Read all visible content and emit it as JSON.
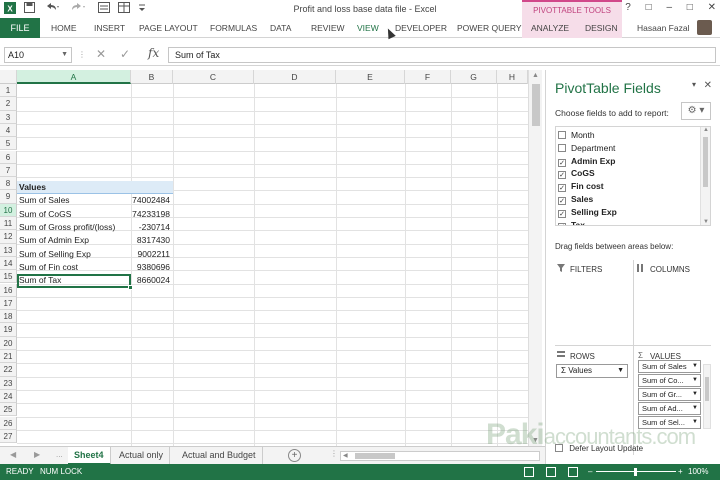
{
  "titlebar": {
    "title": "Profit and loss base data file - Excel",
    "pivot_tools": "PIVOTTABLE TOOLS",
    "help": "?",
    "restore": "□",
    "minimize": "–",
    "restore2": "□",
    "close": "✕"
  },
  "ribbon": {
    "file": "FILE",
    "tabs": [
      "HOME",
      "INSERT",
      "PAGE LAYOUT",
      "FORMULAS",
      "DATA",
      "REVIEW",
      "VIEW",
      "DEVELOPER",
      "POWER QUERY",
      "ANALYZE",
      "DESIGN"
    ],
    "user": "Hasaan Fazal"
  },
  "formula_bar": {
    "name_box": "A10",
    "formula": "Sum of Tax",
    "fx": "fx"
  },
  "grid": {
    "columns": [
      "A",
      "B",
      "C",
      "D",
      "E",
      "F",
      "G",
      "H"
    ],
    "rows": [
      "1",
      "2",
      "3",
      "4",
      "5",
      "6",
      "7",
      "8",
      "9",
      "10",
      "11",
      "12",
      "13",
      "14",
      "15",
      "16",
      "17",
      "18",
      "19",
      "20",
      "21",
      "22",
      "23",
      "24",
      "25",
      "26",
      "27"
    ],
    "header_label": "Values",
    "cells": [
      {
        "label": "Sum of Sales",
        "value": "74002484"
      },
      {
        "label": "Sum of CoGS",
        "value": "74233198"
      },
      {
        "label": "Sum of Gross profit/(loss)",
        "value": "-230714"
      },
      {
        "label": "Sum of Admin Exp",
        "value": "8317430"
      },
      {
        "label": "Sum of Selling Exp",
        "value": "9002211"
      },
      {
        "label": "Sum of Fin cost",
        "value": "9380696"
      },
      {
        "label": "Sum of Tax",
        "value": "8660024"
      }
    ]
  },
  "sheets": {
    "tabs": [
      "Sheet4",
      "Actual only",
      "Actual and Budget"
    ],
    "nav_prev": "◀",
    "nav_next": "▶",
    "more": "...",
    "add": "+"
  },
  "status": {
    "ready": "READY",
    "numlock": "NUM LOCK",
    "zoom": "100%",
    "minus": "–",
    "plus": "+"
  },
  "pivot": {
    "title": "PivotTable Fields",
    "subtitle": "Choose fields to add to report:",
    "fields": [
      {
        "name": "Month",
        "checked": false
      },
      {
        "name": "Department",
        "checked": false
      },
      {
        "name": "Admin Exp",
        "checked": true
      },
      {
        "name": "CoGS",
        "checked": true
      },
      {
        "name": "Fin cost",
        "checked": true
      },
      {
        "name": "Sales",
        "checked": true
      },
      {
        "name": "Selling Exp",
        "checked": true
      },
      {
        "name": "Tax",
        "checked": true
      }
    ],
    "drag_hint": "Drag fields between areas below:",
    "filters": "FILTERS",
    "columns": "COLUMNS",
    "rows": "ROWS",
    "values": "VALUES",
    "rows_item": "Values",
    "values_items": [
      "Sum of Sales",
      "Sum of Co...",
      "Sum of Gr...",
      "Sum of Ad...",
      "Sum of Sel..."
    ],
    "defer": "Defer Layout Update",
    "sigma": "Σ",
    "check": "✓",
    "gear": "⚙ ▾",
    "collapse": "▾",
    "close": "✕"
  },
  "watermark": {
    "brand": "Paki",
    "rest": "accountants.com"
  }
}
